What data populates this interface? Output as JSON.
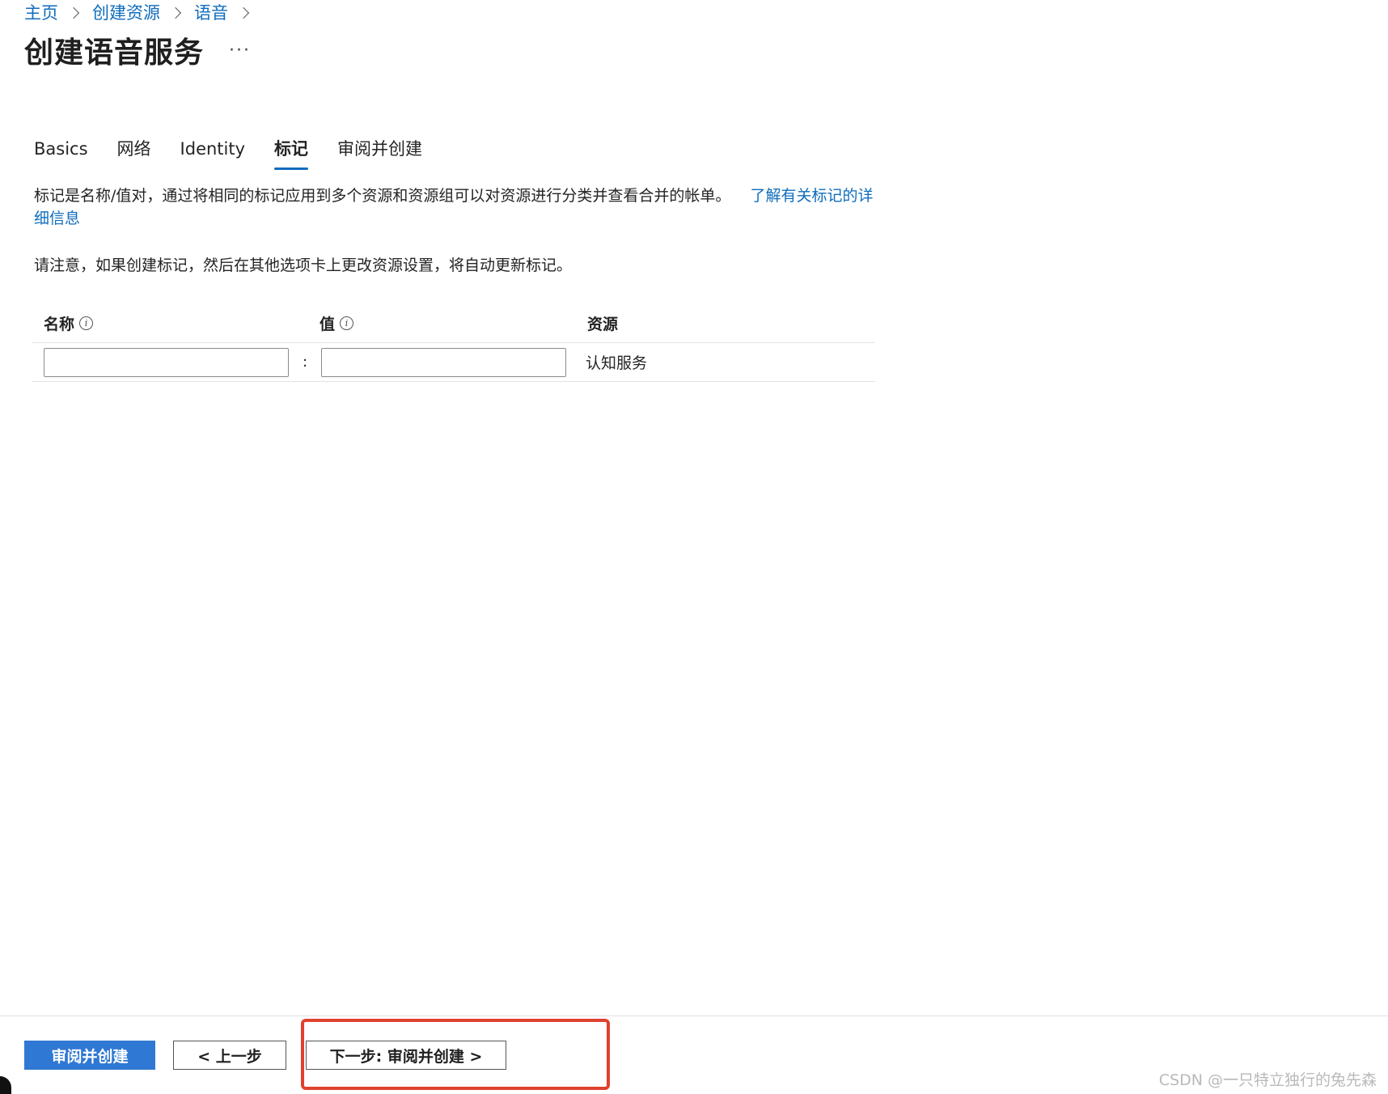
{
  "breadcrumb": [
    {
      "label": "主页"
    },
    {
      "label": "创建资源"
    },
    {
      "label": "语音"
    }
  ],
  "page": {
    "title": "创建语音服务",
    "more": "···"
  },
  "tabs": [
    {
      "label": "Basics",
      "active": false
    },
    {
      "label": "网络",
      "active": false
    },
    {
      "label": "Identity",
      "active": false
    },
    {
      "label": "标记",
      "active": true
    },
    {
      "label": "审阅并创建",
      "active": false
    }
  ],
  "description": {
    "text": "标记是名称/值对，通过将相同的标记应用到多个资源和资源组可以对资源进行分类并查看合并的帐单。",
    "link": "了解有关标记的详细信息",
    "note": "请注意，如果创建标记，然后在其他选项卡上更改资源设置，将自动更新标记。"
  },
  "tag_table": {
    "headers": {
      "name": "名称",
      "value": "值",
      "resource": "资源"
    },
    "rows": [
      {
        "name": "",
        "value": "",
        "separator": ":",
        "resource": "认知服务"
      }
    ]
  },
  "footer": {
    "review_create": "审阅并创建",
    "previous": "< 上一步",
    "next": "下一步: 审阅并创建 >"
  },
  "watermark": "CSDN @一只特立独行的兔先森",
  "colors": {
    "accent": "#0f6cbd",
    "primary_button": "#2f78d3",
    "highlight": "#e0412f"
  }
}
